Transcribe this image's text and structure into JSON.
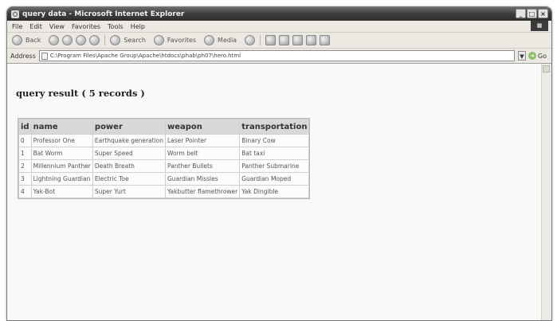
{
  "window": {
    "title": "query data - Microsoft Internet Explorer",
    "controls": {
      "minimize": "_",
      "maximize": "□",
      "close": "×"
    }
  },
  "menubar": {
    "items": [
      "File",
      "Edit",
      "View",
      "Favorites",
      "Tools",
      "Help"
    ]
  },
  "toolbar": {
    "back_label": "Back",
    "search_label": "Search",
    "favorites_label": "Favorites",
    "media_label": "Media"
  },
  "addressbar": {
    "label": "Address",
    "url": "C:\\Program Files\\Apache Group\\Apache\\htdocs\\phab\\ph07\\hero.html",
    "go_label": "Go"
  },
  "page": {
    "heading": "query result ( 5 records )"
  },
  "table": {
    "headers": [
      "id",
      "name",
      "power",
      "weapon",
      "transportation"
    ],
    "rows": [
      [
        "0",
        "Professor One",
        "Earthquake generation",
        "Laser Pointer",
        "Binary Cow"
      ],
      [
        "1",
        "Bat Worm",
        "Super Speed",
        "Worm belt",
        "Bat taxi"
      ],
      [
        "2",
        "Millennium Panther",
        "Death Breath",
        "Panther Bullets",
        "Panther Submarine"
      ],
      [
        "3",
        "Lightning Guardian",
        "Electric Toe",
        "Guardian Missles",
        "Guardian Moped"
      ],
      [
        "4",
        "Yak-Bot",
        "Super Yurt",
        "Yakbutter flamethrower",
        "Yak Dingible"
      ]
    ]
  }
}
